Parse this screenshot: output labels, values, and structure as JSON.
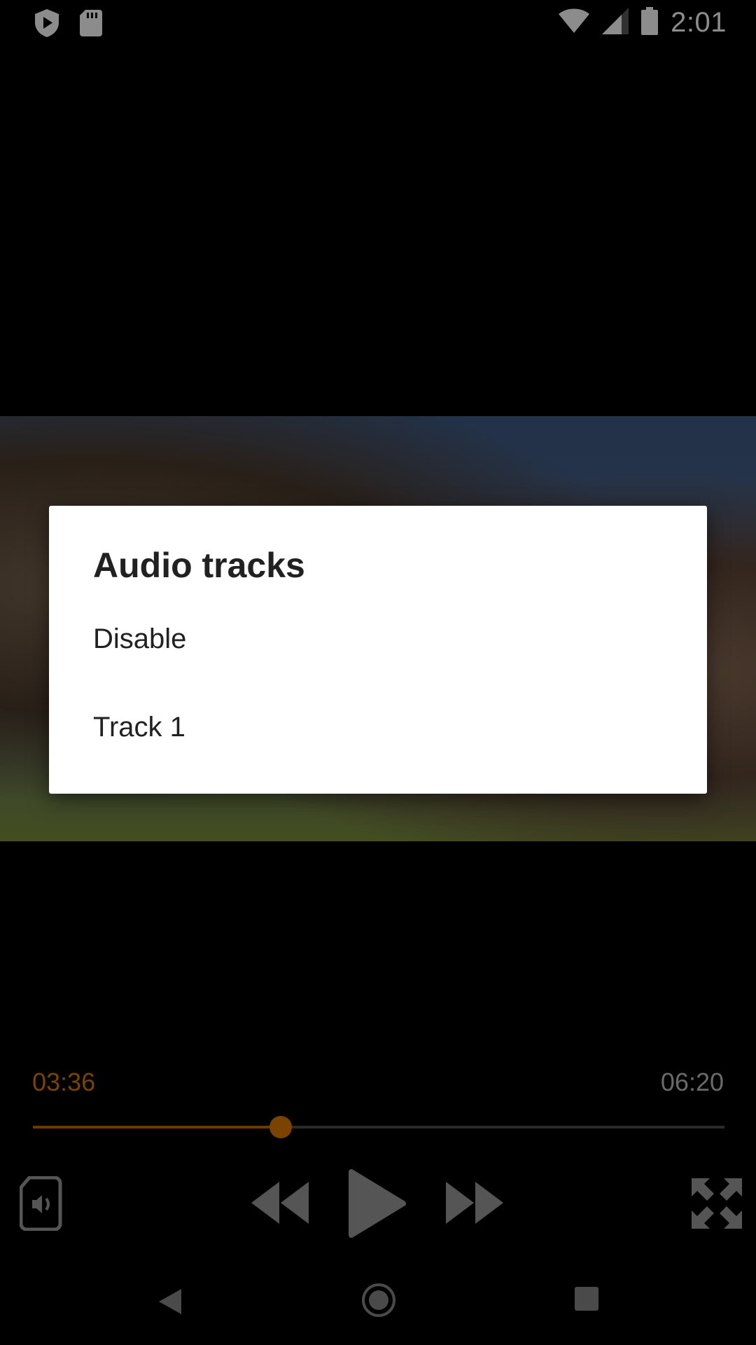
{
  "status_bar": {
    "time": "2:01",
    "icons": [
      "shield-play-icon",
      "sd-card-icon",
      "wifi-icon",
      "signal-icon",
      "battery-icon"
    ]
  },
  "dialog": {
    "title": "Audio tracks",
    "options": [
      "Disable",
      "Track 1"
    ]
  },
  "player": {
    "current_time": "03:36",
    "total_time": "06:20",
    "progress": 0.358,
    "accent_color": "#7a4300",
    "controls": [
      "audio-track-icon",
      "rewind-icon",
      "play-icon",
      "fast-forward-icon",
      "fullscreen-icon"
    ]
  },
  "nav_bar": {
    "buttons": [
      "back-icon",
      "home-icon",
      "recents-icon"
    ]
  }
}
